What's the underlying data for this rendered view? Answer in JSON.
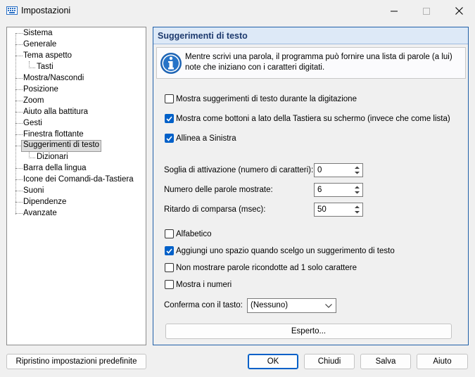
{
  "window": {
    "title": "Impostazioni"
  },
  "tree": {
    "items": [
      {
        "label": "Sistema",
        "level": 0
      },
      {
        "label": "Generale",
        "level": 0
      },
      {
        "label": "Tema aspetto",
        "level": 0
      },
      {
        "label": "Tasti",
        "level": 1
      },
      {
        "label": "Mostra/Nascondi",
        "level": 0
      },
      {
        "label": "Posizione",
        "level": 0
      },
      {
        "label": "Zoom",
        "level": 0
      },
      {
        "label": "Aiuto alla battitura",
        "level": 0
      },
      {
        "label": "Gesti",
        "level": 0
      },
      {
        "label": "Finestra flottante",
        "level": 0
      },
      {
        "label": "Suggerimenti di testo",
        "level": 0,
        "selected": true
      },
      {
        "label": "Dizionari",
        "level": 1
      },
      {
        "label": "Barra della lingua",
        "level": 0
      },
      {
        "label": "Icone dei Comandi-da-Tastiera",
        "level": 0
      },
      {
        "label": "Suoni",
        "level": 0
      },
      {
        "label": "Dipendenze",
        "level": 0
      },
      {
        "label": "Avanzate",
        "level": 0
      }
    ]
  },
  "panel": {
    "title": "Suggerimenti di testo",
    "info": "Mentre scrivi una parola, il programma può fornire una lista di parole (a lui) note che iniziano con i caratteri digitati.",
    "show_suggestions": {
      "label": "Mostra suggerimenti di testo durante la digitazione",
      "checked": false
    },
    "show_as_buttons": {
      "label": "Mostra come bottoni a lato della Tastiera su schermo (invece che come lista)",
      "checked": true
    },
    "align_left": {
      "label": "Allinea a Sinistra",
      "checked": true
    },
    "threshold": {
      "label": "Soglia di attivazione (numero di caratteri):",
      "value": "0"
    },
    "word_count": {
      "label": "Numero delle parole mostrate:",
      "value": "6"
    },
    "delay": {
      "label": "Ritardo di comparsa (msec):",
      "value": "50"
    },
    "alphabetic": {
      "label": "Alfabetico",
      "checked": false
    },
    "add_space": {
      "label": "Aggiungi uno spazio quando scelgo un suggerimento di testo",
      "checked": true
    },
    "no_single_char": {
      "label": "Non mostrare parole ricondotte ad 1 solo carattere",
      "checked": false
    },
    "show_numbers": {
      "label": "Mostra i numeri",
      "checked": false
    },
    "confirm_key": {
      "label": "Conferma con il tasto:",
      "value": "(Nessuno)"
    },
    "expert_button": "Esperto..."
  },
  "footer": {
    "reset": "Ripristino impostazioni predefinite",
    "ok": "OK",
    "close": "Chiudi",
    "save": "Salva",
    "help": "Aiuto"
  },
  "colors": {
    "accent": "#0060c8",
    "header_bg": "#dde9f7",
    "title_text": "#1d3a6e"
  }
}
